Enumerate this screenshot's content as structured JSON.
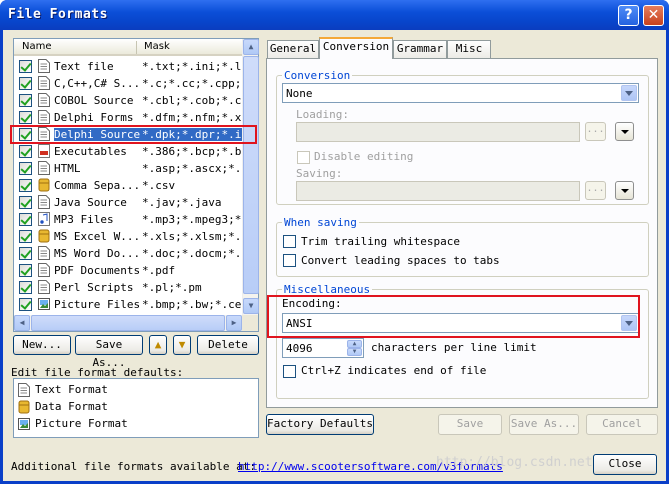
{
  "window": {
    "title": "File Formats",
    "help_label": "?",
    "close_label": "✕"
  },
  "list": {
    "headers": {
      "name": "Name",
      "mask": "Mask"
    },
    "rows": [
      {
        "name": "Text file",
        "mask": "*.txt;*.ini;*.lo",
        "icon": "text-file-icon"
      },
      {
        "name": "C,C++,C# S...",
        "mask": "*.c;*.cc;*.cpp;.",
        "icon": "text-file-icon"
      },
      {
        "name": "COBOL Source",
        "mask": "*.cbl;*.cob;*.cp",
        "icon": "text-file-icon"
      },
      {
        "name": "Delphi Forms",
        "mask": "*.dfm;*.nfm;*.xf",
        "icon": "text-file-icon"
      },
      {
        "name": "Delphi Source",
        "mask": "*.dpk;*.dpr;*.i",
        "icon": "text-file-icon",
        "selected": true
      },
      {
        "name": "Executables",
        "mask": "*.386;*.bcp;*.b.",
        "icon": "exe-file-icon"
      },
      {
        "name": "HTML",
        "mask": "*.asp;*.ascx;*..",
        "icon": "text-file-icon"
      },
      {
        "name": "Comma Sepa...",
        "mask": "*.csv",
        "icon": "data-file-icon"
      },
      {
        "name": "Java Source",
        "mask": "*.jav;*.java",
        "icon": "text-file-icon"
      },
      {
        "name": "MP3 Files",
        "mask": "*.mp3;*.mpeg3;*.",
        "icon": "music-file-icon"
      },
      {
        "name": "MS Excel W...",
        "mask": "*.xls;*.xlsm;*..",
        "icon": "data-file-icon"
      },
      {
        "name": "MS Word Do...",
        "mask": "*.doc;*.docm;*.",
        "icon": "text-file-icon"
      },
      {
        "name": "PDF Documents",
        "mask": "*.pdf",
        "icon": "text-file-icon"
      },
      {
        "name": "Perl Scripts",
        "mask": "*.pl;*.pm",
        "icon": "text-file-icon"
      },
      {
        "name": "Picture Files",
        "mask": "*.bmp;*.bw;*.ce",
        "icon": "picture-file-icon"
      }
    ],
    "buttons": {
      "new": "New...",
      "save_as": "Save As...",
      "up": "▲",
      "down": "▼",
      "delete": "Delete"
    }
  },
  "defaults": {
    "label": "Edit file format defaults:",
    "items": [
      {
        "label": "Text Format",
        "icon": "text-file-icon"
      },
      {
        "label": "Data Format",
        "icon": "data-file-icon"
      },
      {
        "label": "Picture Format",
        "icon": "picture-file-icon"
      }
    ]
  },
  "tabs": [
    "General",
    "Conversion",
    "Grammar",
    "Misc"
  ],
  "active_tab": "Conversion",
  "conversion": {
    "group_title": "Conversion",
    "value": "None",
    "loading_label": "Loading:",
    "disable_editing_label": "Disable editing",
    "saving_label": "Saving:",
    "browse_label": "..."
  },
  "when_saving": {
    "group_title": "When saving",
    "trim_label": "Trim trailing whitespace",
    "convert_label": "Convert leading spaces to tabs"
  },
  "misc": {
    "group_title": "Miscellaneous",
    "encoding_label": "Encoding:",
    "encoding_value": "ANSI",
    "chars_value": "4096",
    "chars_label": "characters per line limit",
    "ctrlz_label": "Ctrl+Z indicates end of file"
  },
  "bottom": {
    "factory_defaults": "Factory Defaults",
    "save": "Save",
    "save_as": "Save As...",
    "cancel": "Cancel",
    "close": "Close",
    "footer_text": "Additional file formats available at:",
    "footer_link": "http://www.scootersoftware.com/v3formats",
    "watermark": "http://blog.csdn.net/"
  },
  "colors": {
    "highlight": "#e0141e",
    "selection": "#316ac5",
    "group_title": "#0046d5"
  }
}
